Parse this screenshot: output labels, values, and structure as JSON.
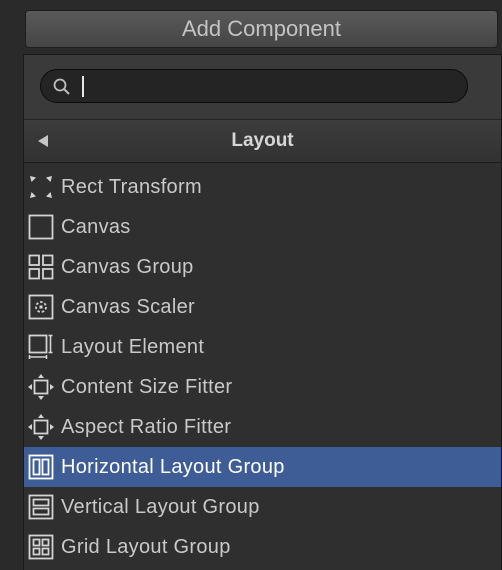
{
  "add_component": {
    "label": "Add Component"
  },
  "search": {
    "value": "",
    "placeholder": ""
  },
  "header": {
    "title": "Layout"
  },
  "items": [
    {
      "label": "Rect Transform",
      "icon": "rect-transform-icon"
    },
    {
      "label": "Canvas",
      "icon": "canvas-icon"
    },
    {
      "label": "Canvas Group",
      "icon": "canvas-group-icon"
    },
    {
      "label": "Canvas Scaler",
      "icon": "canvas-scaler-icon"
    },
    {
      "label": "Layout Element",
      "icon": "layout-element-icon"
    },
    {
      "label": "Content Size Fitter",
      "icon": "content-size-fitter-icon"
    },
    {
      "label": "Aspect Ratio Fitter",
      "icon": "aspect-ratio-fitter-icon"
    },
    {
      "label": "Horizontal Layout Group",
      "icon": "horizontal-layout-group-icon",
      "selected": true
    },
    {
      "label": "Vertical Layout Group",
      "icon": "vertical-layout-group-icon"
    },
    {
      "label": "Grid Layout Group",
      "icon": "grid-layout-group-icon"
    }
  ],
  "colors": {
    "selection": "#3e5d96",
    "background": "#2f2f2f",
    "text": "#c9c9c9"
  }
}
